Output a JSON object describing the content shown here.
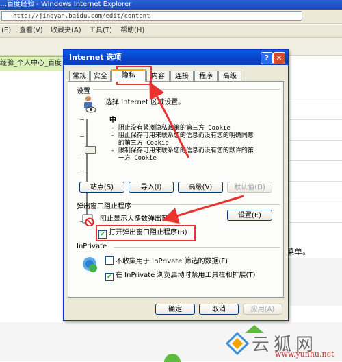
{
  "browser": {
    "title": "…百度经验 - Windows Internet Explorer",
    "address": "http://jingyan.baidu.com/edit/content",
    "menu": [
      "查看(V)",
      "收藏夹(A)",
      "工具(T)",
      "帮助(H)"
    ],
    "menu_prefix": "(E)",
    "tab_label": "经验_个人中心_百度",
    "page_suffix": "菜单。"
  },
  "dialog": {
    "title": "Internet 选项",
    "help_glyph": "?",
    "close_glyph": "✕",
    "tabs": [
      "常规",
      "安全",
      "隐私",
      "内容",
      "连接",
      "程序",
      "高级"
    ],
    "active_tab": "隐私",
    "settings": {
      "group_label": "设置",
      "choose_text": "选择 Internet 区域设置。",
      "level": "中",
      "description": "- 阻止没有紧凑隐私政策的第三方 Cookie\n- 阻止保存可用来联系您的信息而没有您的明确同意\n  的第三方 Cookie\n- 限制保存可用来联系您的信息而没有您的默许的第\n  一方 Cookie",
      "buttons": [
        "站点(S)",
        "导入(I)",
        "高级(V)",
        "默认值(D)"
      ]
    },
    "popup": {
      "group_label": "弹出窗口阻止程序",
      "text": "阻止显示大多数弹出窗口。",
      "settings_button": "设置(E)",
      "enable_label": "打开弹出窗口阻止程序(B)",
      "enable_checked": true
    },
    "inprivate": {
      "group_label": "InPrivate",
      "no_collect_label": "不收集用于 InPrivate 筛选的数据(F)",
      "no_collect_checked": false,
      "disable_label": "在 InPrivate 浏览启动时禁用工具栏和扩展(T)",
      "disable_checked": true
    },
    "footer": {
      "ok": "确定",
      "cancel": "取消",
      "apply": "应用(A)"
    }
  },
  "watermark": {
    "text": "云狐网",
    "url": "www.yunhu.net"
  },
  "colors": {
    "highlight": "#e8332f",
    "title_blue": "#0842c7",
    "watermark_green": "#5fbb3d"
  }
}
